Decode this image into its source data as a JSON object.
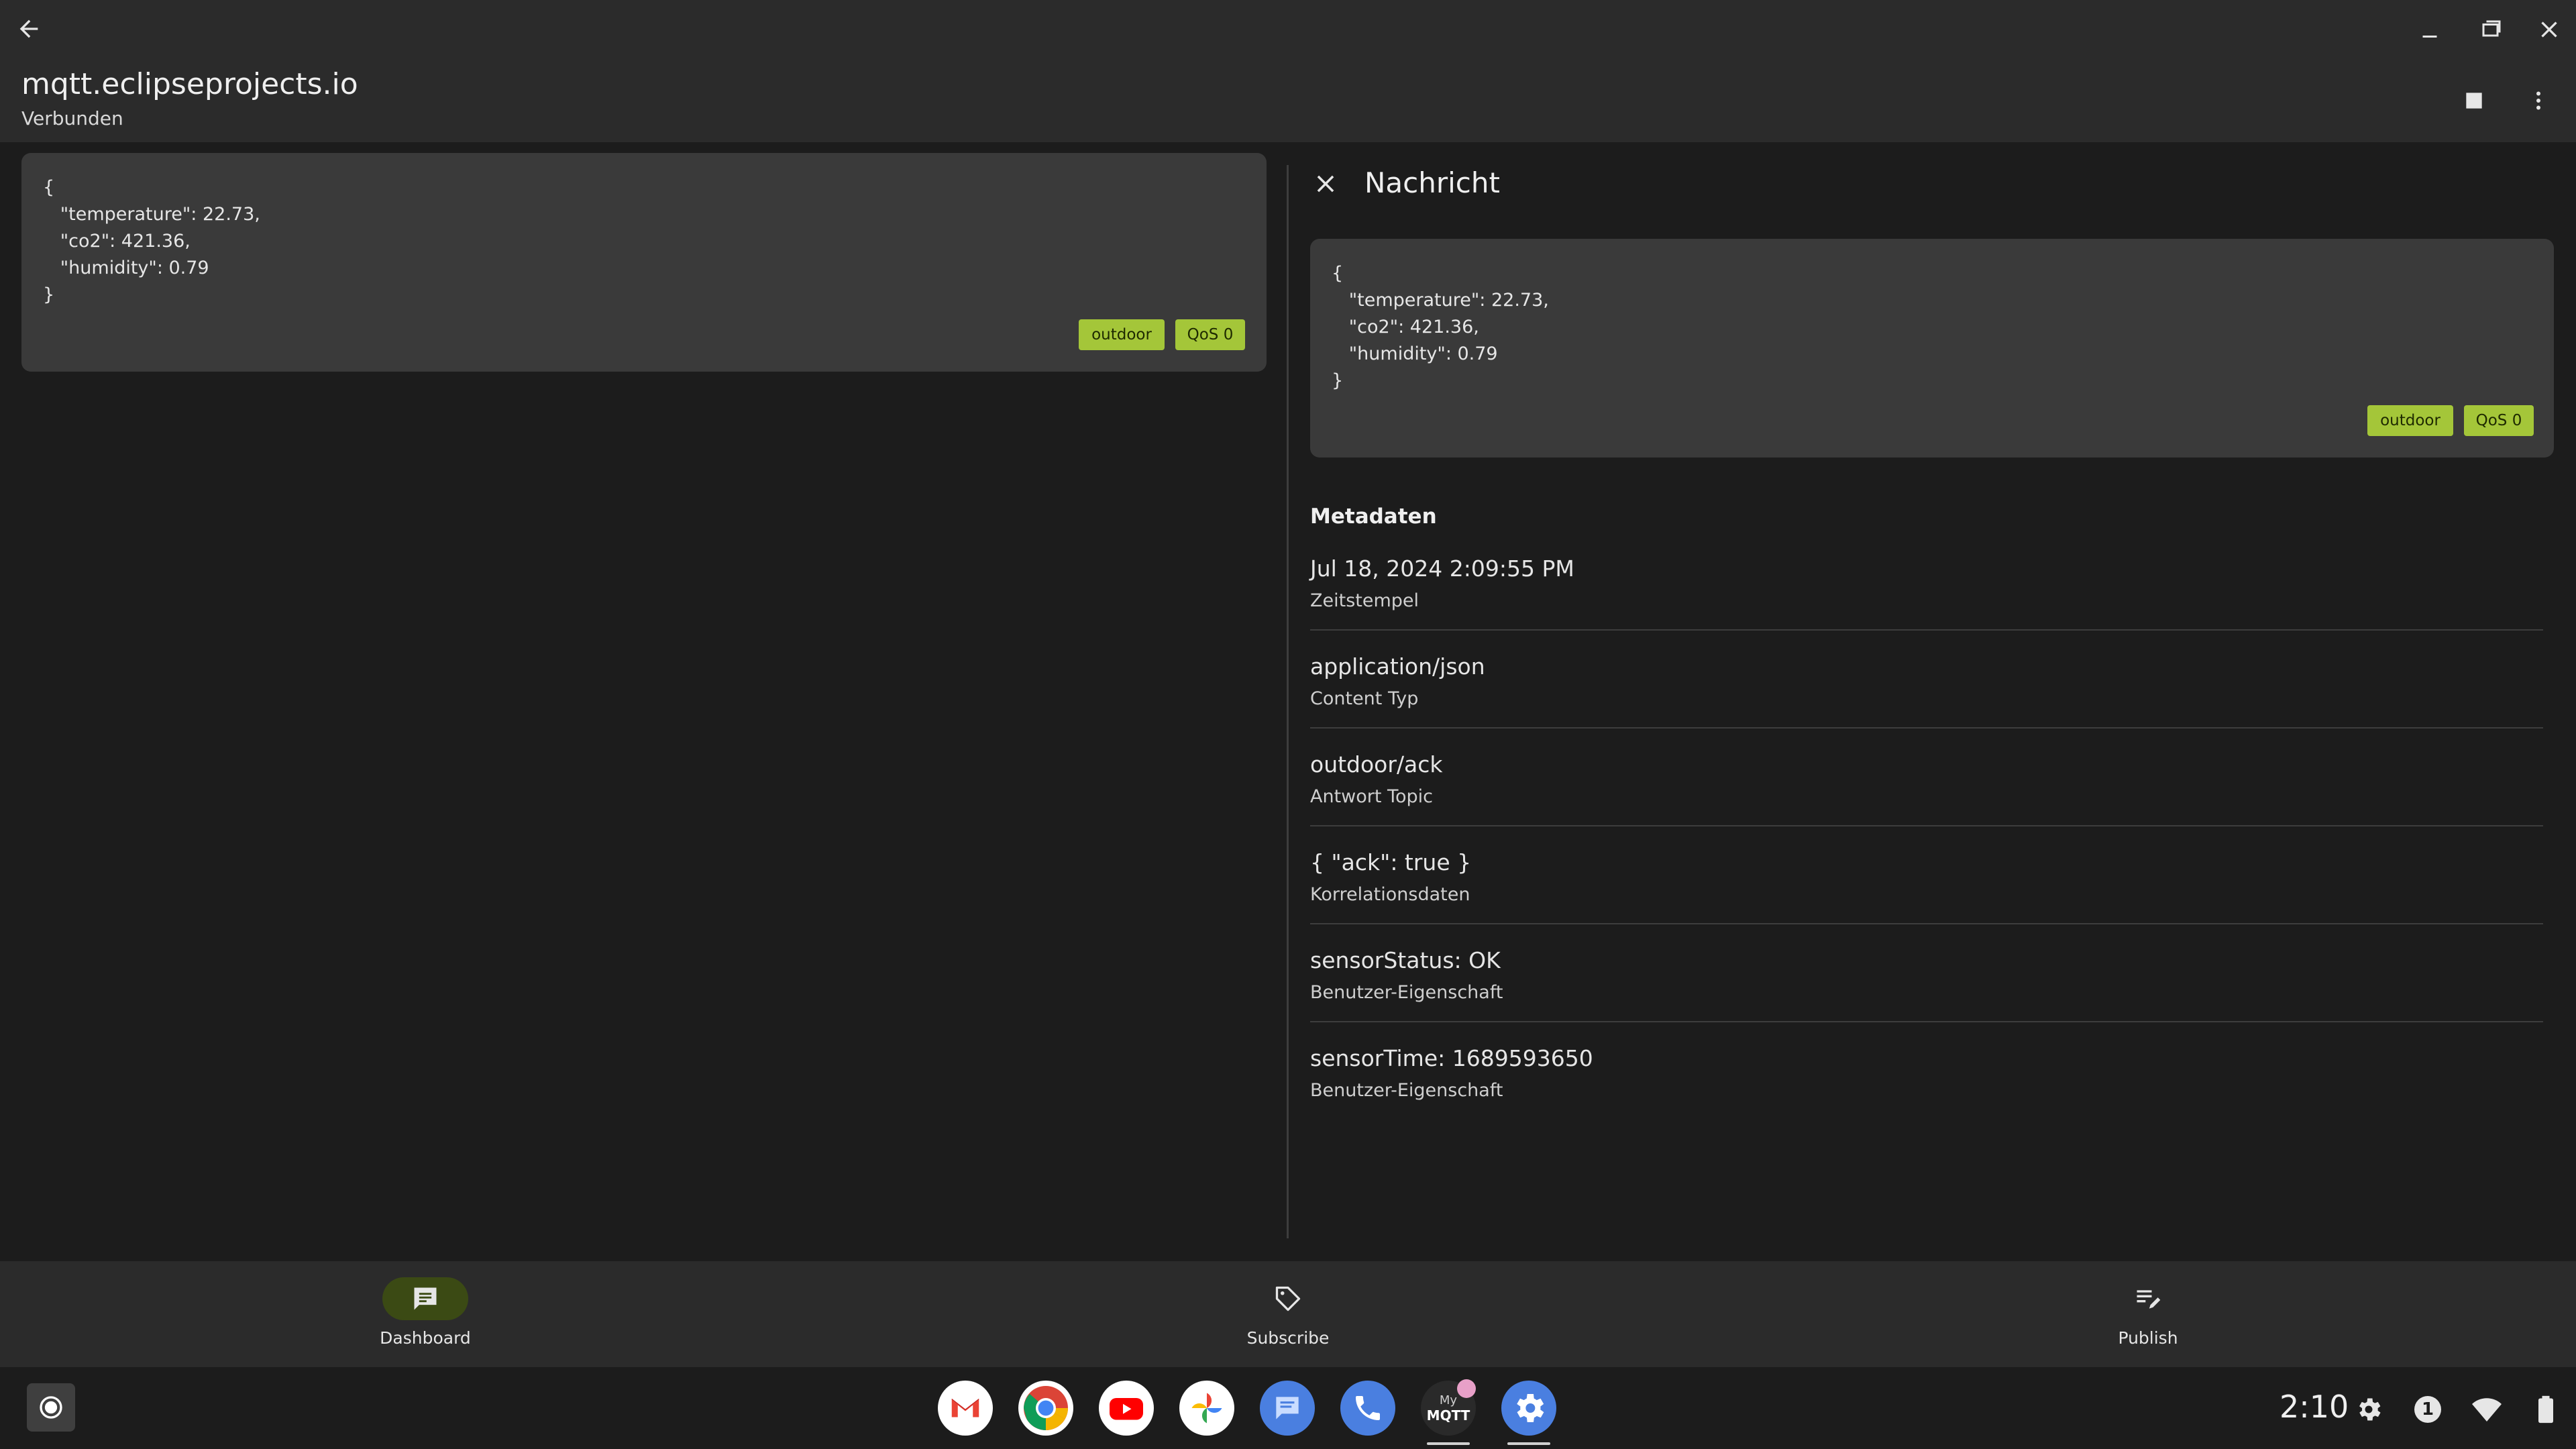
{
  "appbar": {
    "title": "mqtt.eclipseprojects.io",
    "status": "Verbunden"
  },
  "list": {
    "message": {
      "payload": "{\n   \"temperature\": 22.73,\n   \"co2\": 421.36,\n   \"humidity\": 0.79\n}",
      "topic_badge": "outdoor",
      "qos_badge": "QoS 0"
    }
  },
  "detail": {
    "title": "Nachricht",
    "payload": "{\n   \"temperature\": 22.73,\n   \"co2\": 421.36,\n   \"humidity\": 0.79\n}",
    "topic_badge": "outdoor",
    "qos_badge": "QoS 0",
    "metadata_title": "Metadaten",
    "metadata": [
      {
        "value": "Jul 18, 2024 2:09:55 PM",
        "label": "Zeitstempel"
      },
      {
        "value": "application/json",
        "label": "Content Typ"
      },
      {
        "value": "outdoor/ack",
        "label": "Antwort Topic"
      },
      {
        "value": "{ \"ack\": true }",
        "label": "Korrelationsdaten"
      },
      {
        "value": "sensorStatus: OK",
        "label": "Benutzer-Eigenschaft"
      },
      {
        "value": "sensorTime: 1689593650",
        "label": "Benutzer-Eigenschaft"
      }
    ]
  },
  "bottom_nav": {
    "items": [
      {
        "label": "Dashboard",
        "icon": "dashboard-message-icon",
        "active": true
      },
      {
        "label": "Subscribe",
        "icon": "tag-icon",
        "active": false
      },
      {
        "label": "Publish",
        "icon": "edit-list-icon",
        "active": false
      }
    ]
  },
  "taskbar": {
    "apps": [
      "gmail",
      "chrome",
      "youtube",
      "photos",
      "messages",
      "phone",
      "mymqtt",
      "settings"
    ],
    "mymqtt_label_top": "My",
    "mymqtt_label_bottom": "MQTT",
    "clock": "2:10",
    "notification_count": "1"
  },
  "colors": {
    "badge": "#a4c639",
    "card": "#3a3a3a",
    "background": "#1c1c1c",
    "bar": "#2b2b2b",
    "active_pill": "#3b4a14"
  }
}
